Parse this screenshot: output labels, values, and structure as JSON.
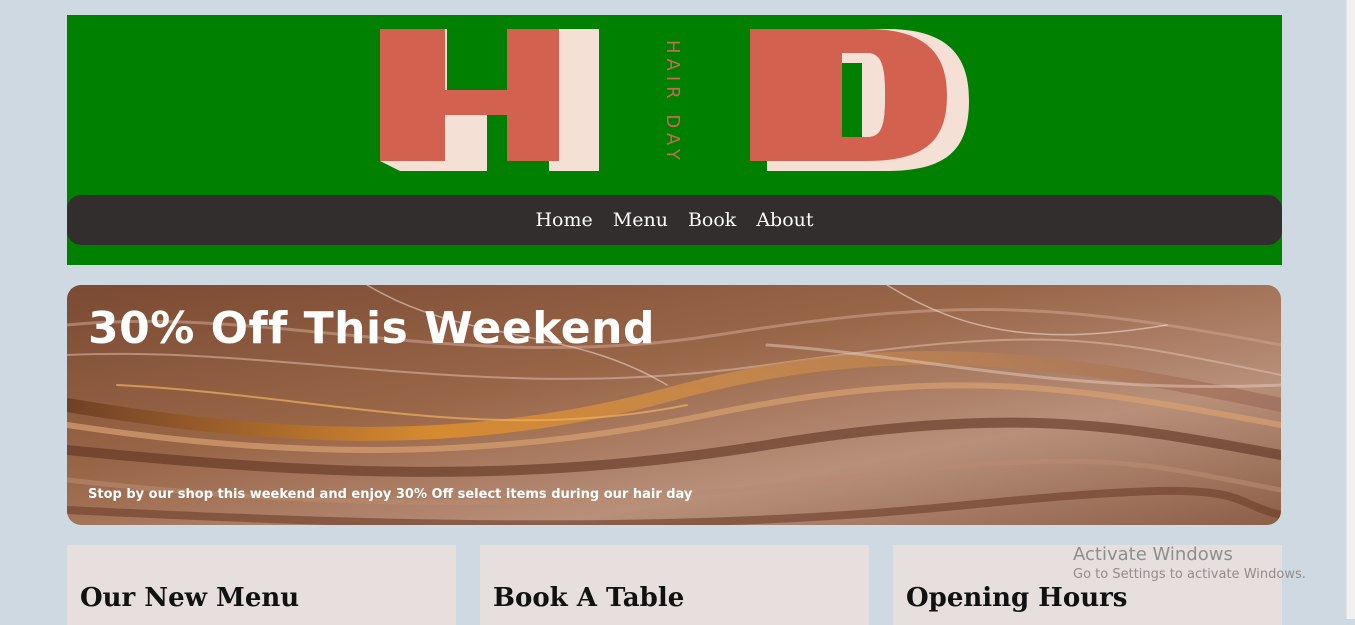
{
  "brand": {
    "letter_left": "H",
    "letter_right": "D",
    "tagline": "HAIR DAY"
  },
  "nav": {
    "items": [
      "Home",
      "Menu",
      "Book",
      "About"
    ]
  },
  "hero": {
    "title": "30% Off This Weekend",
    "subtitle": "Stop by our shop this weekend and enjoy 30% Off select items during our hair day"
  },
  "cards": [
    {
      "title": "Our New Menu"
    },
    {
      "title": "Book A Table"
    },
    {
      "title": "Opening Hours"
    }
  ],
  "watermark": {
    "line1": "Activate Windows",
    "line2": "Go to Settings to activate Windows."
  },
  "colors": {
    "page_bg": "#cfd9e2",
    "header_bg": "#008000",
    "nav_bg": "#322e2e",
    "logo_red": "#d3614f",
    "logo_cream": "#f4e0d4",
    "card_bg": "#e6dfde"
  }
}
